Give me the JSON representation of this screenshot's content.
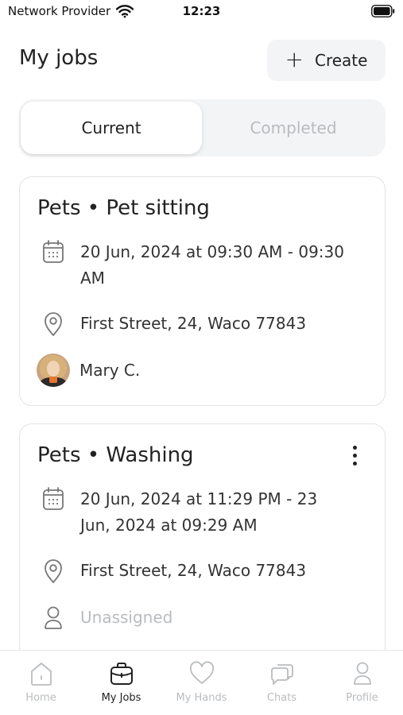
{
  "status_bar": {
    "carrier": "Network Provider",
    "time": "12:23"
  },
  "header": {
    "title": "My jobs",
    "create_label": "Create"
  },
  "segments": {
    "current_label": "Current",
    "completed_label": "Completed",
    "selected": "Current"
  },
  "jobs": [
    {
      "title": "Pets • Pet sitting",
      "date_line1": "20 Jun, 2024 at 09:30 AM - 09:30",
      "date_line2": "AM",
      "address": "First Street, 24, Waco 77843",
      "assignee": "Mary C."
    },
    {
      "title": "Pets • Washing",
      "date_line1": "20 Jun, 2024 at 11:29 PM - 23",
      "date_line2": "Jun, 2024 at 09:29 AM",
      "address": "First Street, 24, Waco 77843",
      "assignee": "Unassigned"
    }
  ],
  "tabs": [
    {
      "label": "Home",
      "icon": "home-icon"
    },
    {
      "label": "My Jobs",
      "icon": "briefcase-icon",
      "active": true
    },
    {
      "label": "My Hands",
      "icon": "heart-icon"
    },
    {
      "label": "Chats",
      "icon": "chat-icon"
    },
    {
      "label": "Profile",
      "icon": "profile-icon"
    }
  ],
  "colors": {
    "text": "#222222",
    "muted": "#b9bcbf",
    "surface": "#f3f4f5",
    "border": "#e1e3e6"
  }
}
